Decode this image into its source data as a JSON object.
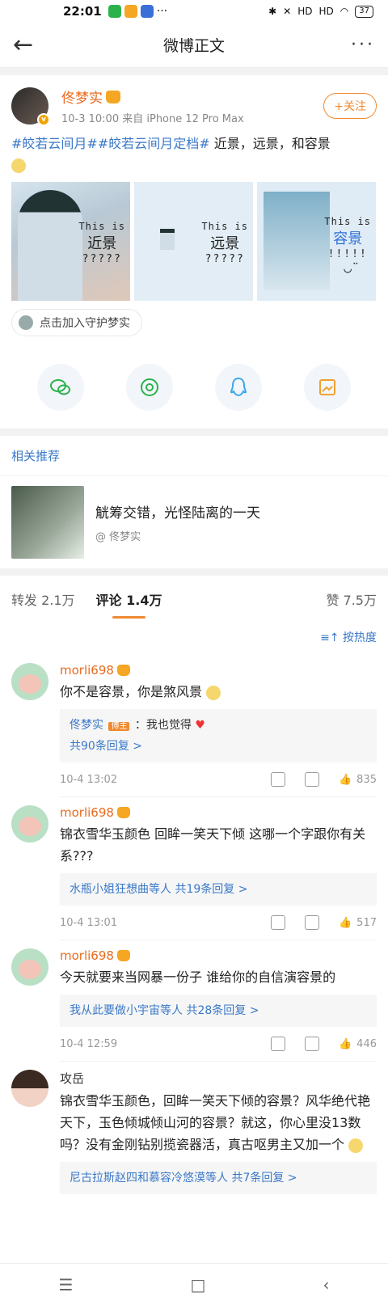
{
  "status": {
    "time": "22:01",
    "dots": "···",
    "signal1": "HD",
    "signal2": "HD",
    "battery": "37"
  },
  "nav": {
    "back": "←",
    "title": "微博正文",
    "more": "···"
  },
  "post": {
    "author": "佟梦实",
    "meta": "10-3 10:00   来自 iPhone 12 Pro Max",
    "follow": "+关注",
    "tag1": "#皎若云间月#",
    "tag2": "#皎若云间月定档#",
    "text": " 近景，远景，和容景",
    "images": [
      {
        "l1": "This is",
        "l2": "近景",
        "l3": "?????"
      },
      {
        "l1": "This is",
        "l2": "远景",
        "l3": "?????"
      },
      {
        "l1": "This is",
        "l2": "容景",
        "l3": "!!!!!"
      }
    ],
    "guard": "点击加入守护梦实"
  },
  "related": {
    "title": "相关推荐",
    "item_title": "觥筹交错，光怪陆离的一天",
    "item_author": "@ 佟梦实"
  },
  "tabs": {
    "repost": "转发 2.1万",
    "comment": "评论 1.4万",
    "like": "赞 7.5万"
  },
  "sort": "按热度",
  "comments": [
    {
      "name": "morli698",
      "text": "你不是容景，你是煞风景",
      "reply_name": "佟梦实",
      "reply_badge": "博主",
      "reply_text": "：我也觉得",
      "reply_more": "共90条回复 >",
      "date": "10-4 13:02",
      "likes": "835"
    },
    {
      "name": "morli698",
      "text": "锦衣雪华玉颜色 回眸一笑天下倾  这哪一个字跟你有关系???",
      "reply_names": "水瓶小姐狂想曲等人",
      "reply_more": "共19条回复 >",
      "date": "10-4 13:01",
      "likes": "517"
    },
    {
      "name": "morli698",
      "text": "今天就要来当网暴一份子   谁给你的自信演容景的",
      "reply_names": "我从此要做小宇宙等人",
      "reply_more": "共28条回复 >",
      "date": "10-4 12:59",
      "likes": "446"
    },
    {
      "name": "攻岳",
      "text": "锦衣雪华玉颜色，回眸一笑天下倾的容景？风华绝代艳天下，玉色倾城倾山河的容景？就这，你心里没13数吗？没有金刚钻别揽瓷器活，真古呕男主又加一个",
      "reply_names": "尼古拉斯赵四和慕容冷悠漠等人",
      "reply_more": "共7条回复 >"
    }
  ],
  "bottom_nav": {
    "menu": "☰",
    "home": "□",
    "back": "‹"
  }
}
